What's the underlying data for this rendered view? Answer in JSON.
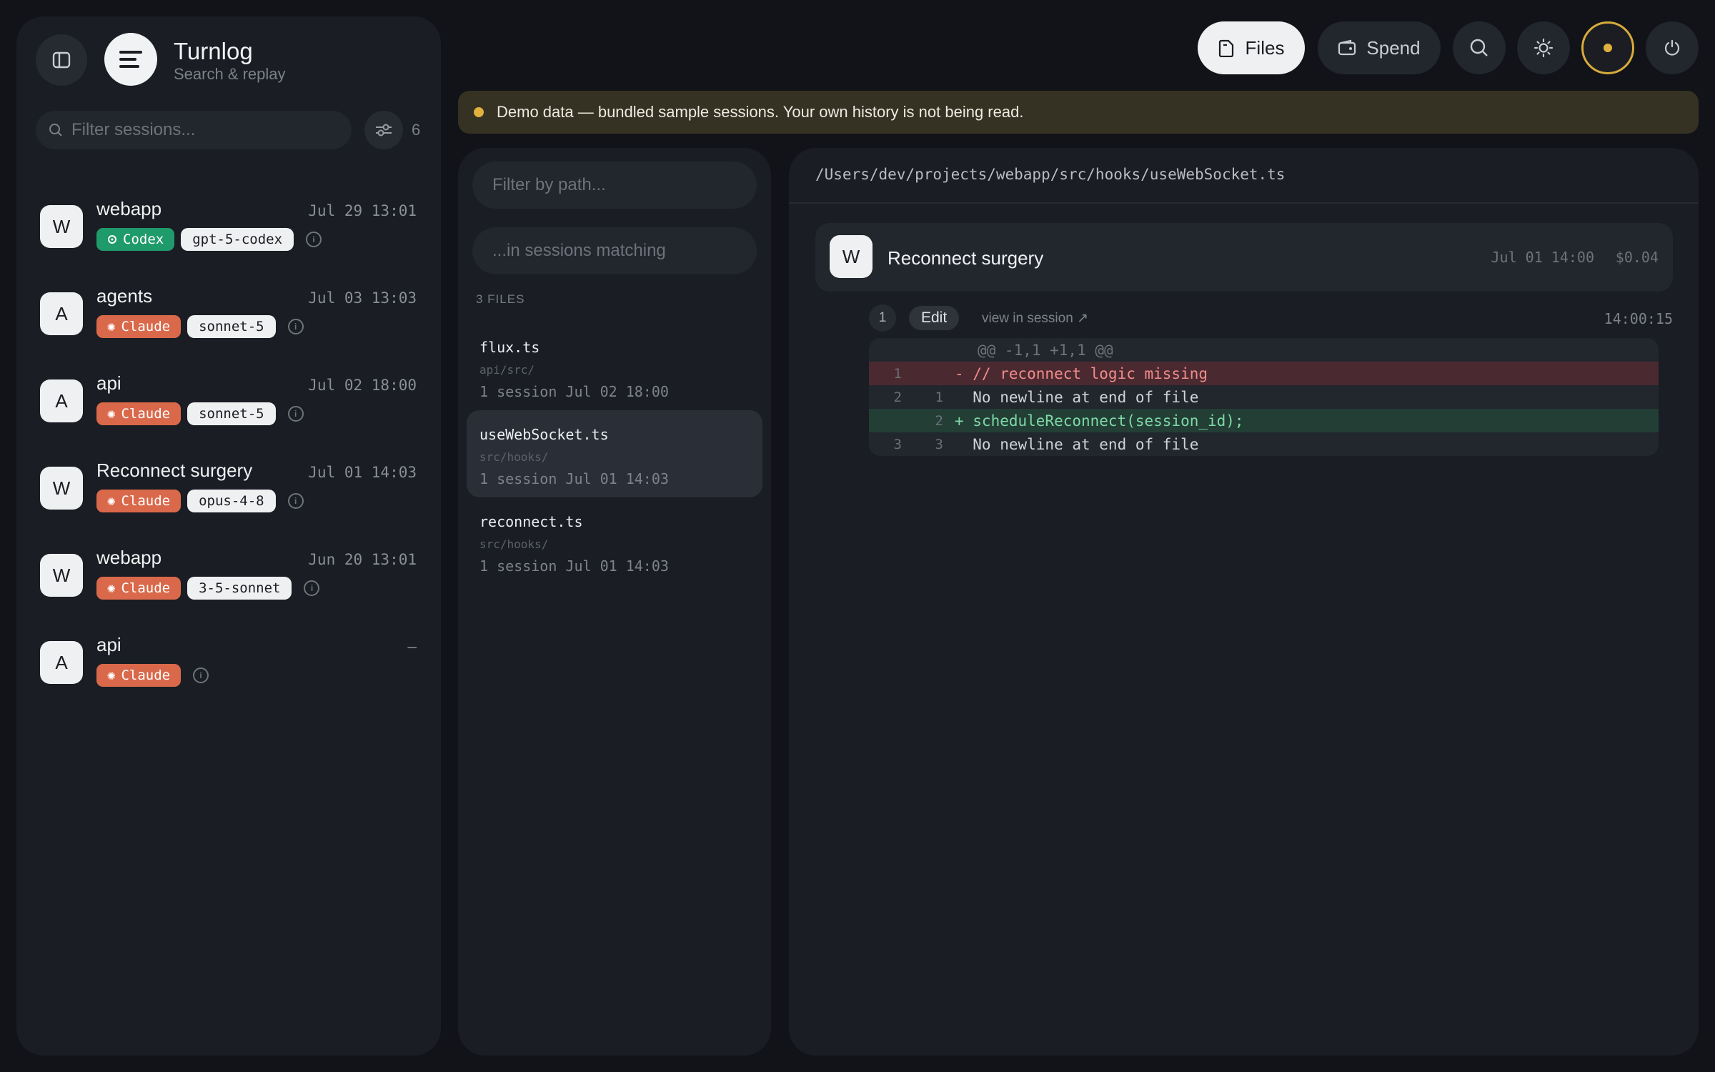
{
  "app": {
    "title": "Turnlog",
    "subtitle": "Search & replay"
  },
  "sidebar": {
    "filter_placeholder": "Filter sessions...",
    "session_count": "6",
    "sessions": [
      {
        "initial": "W",
        "name": "webapp",
        "time": "Jul 29 13:01",
        "agent": "Codex",
        "agent_kind": "codex",
        "model": "gpt-5-codex"
      },
      {
        "initial": "A",
        "name": "agents",
        "time": "Jul 03 13:03",
        "agent": "Claude",
        "agent_kind": "claude",
        "model": "sonnet-5"
      },
      {
        "initial": "A",
        "name": "api",
        "time": "Jul 02 18:00",
        "agent": "Claude",
        "agent_kind": "claude",
        "model": "sonnet-5"
      },
      {
        "initial": "W",
        "name": "Reconnect surgery",
        "time": "Jul 01 14:03",
        "agent": "Claude",
        "agent_kind": "claude",
        "model": "opus-4-8"
      },
      {
        "initial": "W",
        "name": "webapp",
        "time": "Jun 20 13:01",
        "agent": "Claude",
        "agent_kind": "claude",
        "model": "3-5-sonnet"
      },
      {
        "initial": "A",
        "name": "api",
        "time": "–",
        "agent": "Claude",
        "agent_kind": "claude",
        "model": ""
      }
    ]
  },
  "topbar": {
    "files_label": "Files",
    "spend_label": "Spend",
    "icons": [
      "search-icon",
      "sun-icon",
      "status-dot-icon",
      "power-icon"
    ]
  },
  "banner": {
    "text": "Demo data — bundled sample sessions. Your own history is not being read."
  },
  "files_panel": {
    "path_placeholder": "Filter by path...",
    "match_placeholder": "...in sessions matching",
    "count_label": "3 FILES",
    "files": [
      {
        "name": "flux.ts",
        "dir": "api/src/",
        "meta": "1 session  Jul 02 18:00",
        "selected": false
      },
      {
        "name": "useWebSocket.ts",
        "dir": "src/hooks/",
        "meta": "1 session  Jul 01 14:03",
        "selected": true
      },
      {
        "name": "reconnect.ts",
        "dir": "src/hooks/",
        "meta": "1 session  Jul 01 14:03",
        "selected": false
      }
    ]
  },
  "detail": {
    "path": "/Users/dev/projects/webapp/src/hooks/useWebSocket.ts",
    "session": {
      "initial": "W",
      "title": "Reconnect surgery",
      "time": "Jul 01 14:00",
      "cost": "$0.04"
    },
    "edit": {
      "number": "1",
      "label": "Edit",
      "link": "view in session ↗",
      "time": "14:00:15"
    },
    "diff": [
      {
        "type": "hunk",
        "old": "",
        "new": "",
        "code": "@@ -1,1 +1,1 @@"
      },
      {
        "type": "del",
        "old": "1",
        "new": "",
        "code": "- // reconnect logic missing"
      },
      {
        "type": "ctx",
        "old": "2",
        "new": "1",
        "code": "  No newline at end of file"
      },
      {
        "type": "add",
        "old": "",
        "new": "2",
        "code": "+ scheduleReconnect(session_id);"
      },
      {
        "type": "ctx",
        "old": "3",
        "new": "3",
        "code": "  No newline at end of file"
      }
    ]
  },
  "colors": {
    "claude": "#d9694a",
    "codex": "#1f9a6b",
    "accent_status": "#d6ab3c"
  }
}
